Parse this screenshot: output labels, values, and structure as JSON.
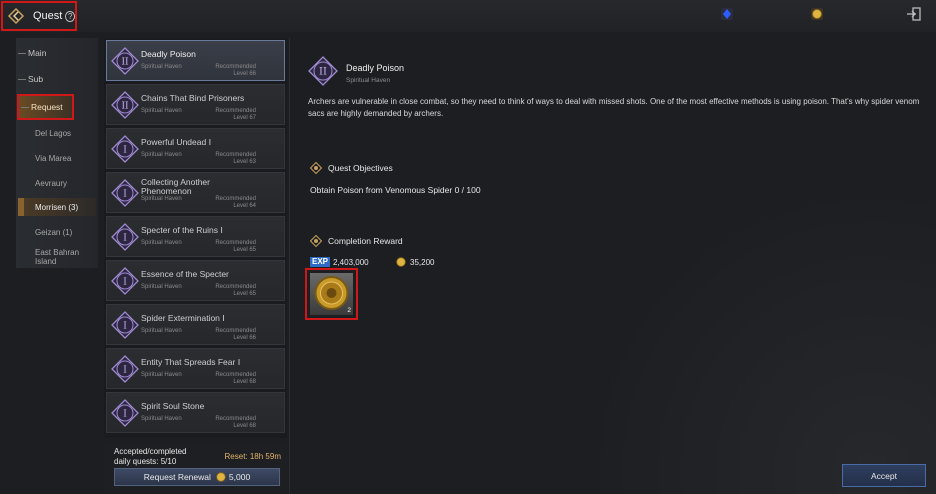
{
  "header": {
    "title": "Quest",
    "help": "?"
  },
  "categories": {
    "main": "Main",
    "sub": "Sub",
    "request": "Request"
  },
  "regions": [
    "Del Lagos",
    "Via Marea",
    "Aevraury",
    "Morrisen (3)",
    "Geizan (1)",
    "East Bahran Island"
  ],
  "quests": [
    {
      "name": "Deadly Poison",
      "location": "Spiritual Haven",
      "rec": "Recommended",
      "level": "Level 66",
      "numeral": "II"
    },
    {
      "name": "Chains That Bind Prisoners",
      "location": "Spiritual Haven",
      "rec": "Recommended",
      "level": "Level 67",
      "numeral": "II"
    },
    {
      "name": "Powerful Undead Ⅰ",
      "location": "Spiritual Haven",
      "rec": "Recommended",
      "level": "Level 63",
      "numeral": "I"
    },
    {
      "name": "Collecting Another Phenomenon",
      "location": "Spiritual Haven",
      "rec": "Recommended",
      "level": "Level 64",
      "numeral": "I"
    },
    {
      "name": "Specter of the Ruins Ⅰ",
      "location": "Spiritual Haven",
      "rec": "Recommended",
      "level": "Level 65",
      "numeral": "I"
    },
    {
      "name": "Essence of the Specter",
      "location": "Spiritual Haven",
      "rec": "Recommended",
      "level": "Level 65",
      "numeral": "I"
    },
    {
      "name": "Spider Extermination Ⅰ",
      "location": "Spiritual Haven",
      "rec": "Recommended",
      "level": "Level 66",
      "numeral": "I"
    },
    {
      "name": "Entity That Spreads Fear Ⅰ",
      "location": "Spiritual Haven",
      "rec": "Recommended",
      "level": "Level 68",
      "numeral": "I"
    },
    {
      "name": "Spirit Soul Stone",
      "location": "Spiritual Haven",
      "rec": "Recommended",
      "level": "Level 68",
      "numeral": "I"
    }
  ],
  "daily": {
    "label": "Accepted/completed daily quests: 5/10",
    "reset": "Reset: 18h 59m",
    "renewal_label": "Request Renewal",
    "renewal_cost": "5,000"
  },
  "detail": {
    "numeral": "II",
    "title": "Deadly Poison",
    "location": "Spiritual Haven",
    "description": "Archers are vulnerable in close combat, so they need to think of ways to deal with missed shots. One of the most effective methods is using poison. That's why spider venom sacs are highly demanded by archers.",
    "objectives_head": "Quest Objectives",
    "objective": "Obtain Poison from Venomous Spider 0 / 100",
    "reward_head": "Completion Reward",
    "exp_badge": "EXP",
    "exp_value": "2,403,000",
    "gold_value": "35,200",
    "reward_count": "2"
  },
  "accept_label": "Accept",
  "colors": {
    "accent": "#d01818",
    "gold": "#e2b46a",
    "selected_border": "#6a7a9a"
  }
}
